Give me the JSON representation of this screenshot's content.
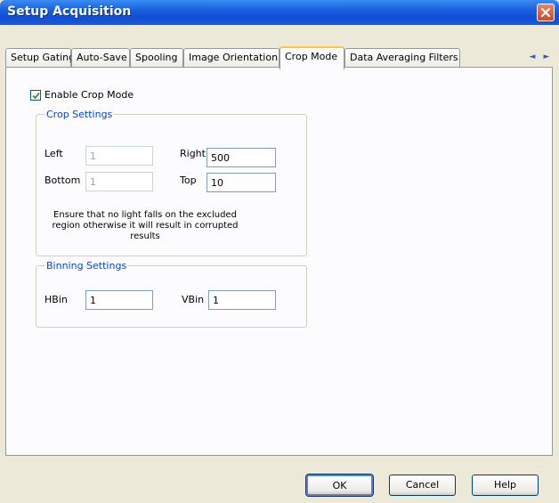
{
  "window": {
    "title": "Setup Acquisition",
    "close_icon": "close-icon"
  },
  "tabs": [
    {
      "label": "Setup Gating",
      "active": false
    },
    {
      "label": "Auto-Save",
      "active": false
    },
    {
      "label": "Spooling",
      "active": false
    },
    {
      "label": "Image Orientation",
      "active": false
    },
    {
      "label": "Crop Mode",
      "active": true
    },
    {
      "label": "Data Averaging Filters",
      "active": false
    }
  ],
  "tab_scroll": {
    "left_icon": "chevron-left-icon",
    "right_icon": "chevron-right-icon",
    "left": "◄",
    "right": "►"
  },
  "crop": {
    "enable_label": "Enable Crop Mode",
    "enable_checked": true,
    "settings_legend": "Crop Settings",
    "left_label": "Left",
    "left_value": "1",
    "right_label": "Right",
    "right_value": "500",
    "bottom_label": "Bottom",
    "bottom_value": "1",
    "top_label": "Top",
    "top_value": "10",
    "note": "Ensure that no light falls on the excluded region otherwise it will result in corrupted results"
  },
  "binning": {
    "legend": "Binning Settings",
    "hbin_label": "HBin",
    "hbin_value": "1",
    "vbin_label": "VBin",
    "vbin_value": "1"
  },
  "buttons": {
    "ok": "OK",
    "cancel": "Cancel",
    "help": "Help"
  },
  "colors": {
    "titlebar": "#0f4fd4",
    "group_legend": "#0046d5",
    "dialog_bg": "#ece9d8"
  }
}
